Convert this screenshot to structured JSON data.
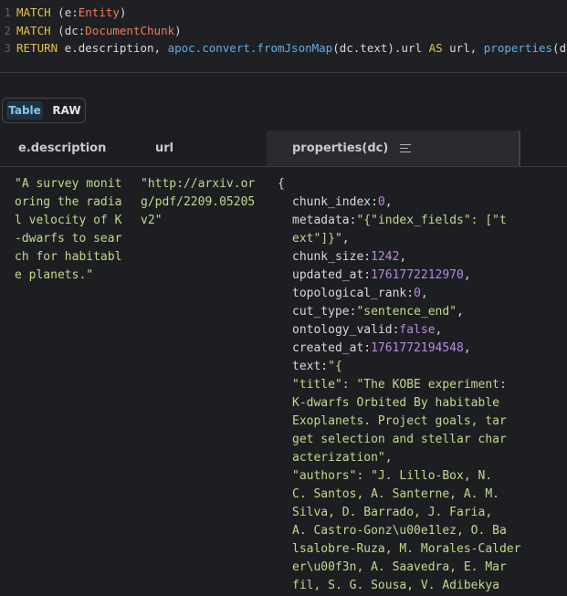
{
  "query": {
    "lines": [
      {
        "num": "1",
        "tokens": [
          {
            "t": "MATCH",
            "c": "kw"
          },
          {
            "t": " (e:",
            "c": "plain"
          },
          {
            "t": "Entity",
            "c": "lbl"
          },
          {
            "t": ")",
            "c": "plain"
          }
        ]
      },
      {
        "num": "2",
        "tokens": [
          {
            "t": "MATCH",
            "c": "kw"
          },
          {
            "t": " (dc:",
            "c": "plain"
          },
          {
            "t": "DocumentChunk",
            "c": "lbl"
          },
          {
            "t": ")",
            "c": "plain"
          }
        ]
      },
      {
        "num": "3",
        "tokens": [
          {
            "t": "RETURN",
            "c": "kw"
          },
          {
            "t": " e.description, ",
            "c": "plain"
          },
          {
            "t": "apoc.convert.fromJsonMap",
            "c": "fn"
          },
          {
            "t": "(dc.text).url ",
            "c": "plain"
          },
          {
            "t": "AS",
            "c": "kw"
          },
          {
            "t": " url, ",
            "c": "plain"
          },
          {
            "t": "properties",
            "c": "fn"
          },
          {
            "t": "(dc)",
            "c": "plain"
          }
        ]
      }
    ]
  },
  "view_toggle": {
    "table_label": "Table",
    "raw_label": "RAW",
    "active": "Table"
  },
  "columns": [
    {
      "label": "e.description"
    },
    {
      "label": "url"
    },
    {
      "label": "properties(dc)"
    }
  ],
  "row": {
    "description_lines": [
      "\"A survey monit",
      "oring the radia",
      "l velocity of K",
      "-dwarfs to sear",
      "ch for habitabl",
      "e planets.\""
    ],
    "url_lines": [
      "\"http://arxiv.or",
      "g/pdf/2209.05205",
      "v2\""
    ],
    "properties_open": "{",
    "properties": [
      {
        "key": "chunk_index:",
        "val": "0",
        "type": "n",
        "suffix": ","
      },
      {
        "key": "metadata:",
        "val": "\"{\"index_fields\": [\"t",
        "type": "s",
        "suffix": ""
      },
      {
        "key": "",
        "val": "ext\"]}\"",
        "type": "s",
        "suffix": ","
      },
      {
        "key": "chunk_size:",
        "val": "1242",
        "type": "n",
        "suffix": ","
      },
      {
        "key": "updated_at:",
        "val": "1761772212970",
        "type": "n",
        "suffix": ","
      },
      {
        "key": "topological_rank:",
        "val": "0",
        "type": "n",
        "suffix": ","
      },
      {
        "key": "cut_type:",
        "val": "\"sentence_end\"",
        "type": "s",
        "suffix": ","
      },
      {
        "key": "ontology_valid:",
        "val": "false",
        "type": "b",
        "suffix": ","
      },
      {
        "key": "created_at:",
        "val": "1761772194548",
        "type": "n",
        "suffix": ","
      },
      {
        "key": "text:",
        "val": "\"{",
        "type": "s",
        "suffix": ""
      },
      {
        "key": "",
        "val": "\"title\": \"The KOBE experiment:",
        "type": "s",
        "suffix": ""
      },
      {
        "key": "",
        "val": "K-dwarfs Orbited By habitable",
        "type": "s",
        "suffix": ""
      },
      {
        "key": "",
        "val": "Exoplanets. Project goals, tar",
        "type": "s",
        "suffix": ""
      },
      {
        "key": "",
        "val": "get selection and stellar char",
        "type": "s",
        "suffix": ""
      },
      {
        "key": "",
        "val": "acterization\",",
        "type": "s",
        "suffix": ""
      },
      {
        "key": "",
        "val": "\"authors\": \"J. Lillo-Box, N.",
        "type": "s",
        "suffix": ""
      },
      {
        "key": "",
        "val": "C. Santos, A. Santerne, A. M.",
        "type": "s",
        "suffix": ""
      },
      {
        "key": "",
        "val": "Silva, D. Barrado, J. Faria,",
        "type": "s",
        "suffix": ""
      },
      {
        "key": "",
        "val": "A. Castro-Gonz\\u00e1lez, O. Ba",
        "type": "s",
        "suffix": ""
      },
      {
        "key": "",
        "val": "lsalobre-Ruza, M. Morales-Calder",
        "type": "s",
        "suffix": ""
      },
      {
        "key": "",
        "val": "er\\u00f3n, A. Saavedra, E. Mar",
        "type": "s",
        "suffix": ""
      },
      {
        "key": "",
        "val": "fil, S. G. Sousa, V. Adibekya",
        "type": "s",
        "suffix": ""
      }
    ]
  },
  "colors": {
    "background": "#1d1e22",
    "keyword": "#e8c04a",
    "label": "#f07a5c",
    "function": "#61aee8",
    "string": "#c4d88a",
    "number": "#b68ae0",
    "active_toggle_bg": "#1e3342",
    "active_toggle_text": "#8ac6ee"
  },
  "icons": {
    "column_menu": "menu-lines-icon"
  }
}
